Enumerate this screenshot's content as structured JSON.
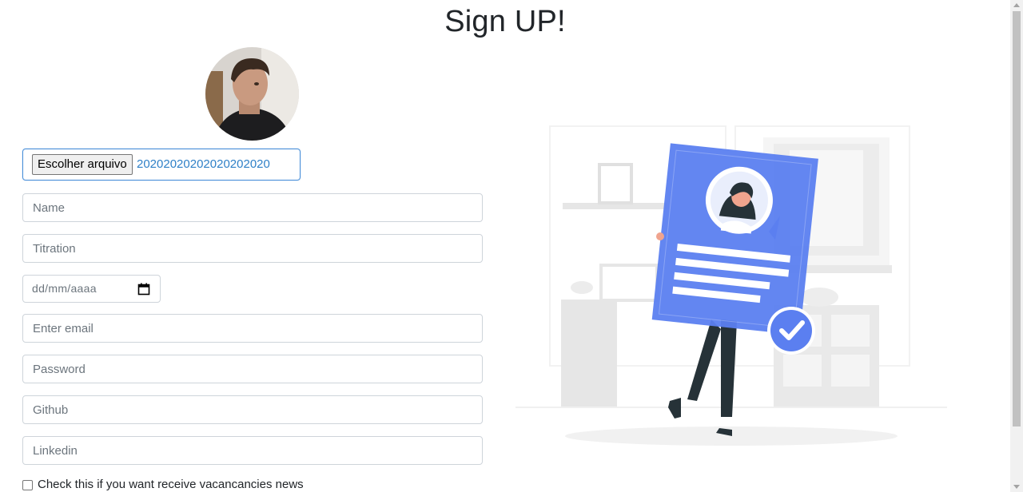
{
  "page": {
    "title": "Sign UP!"
  },
  "avatar": {
    "icon": "profile-photo"
  },
  "file_input": {
    "button_label": "Escolher arquivo",
    "file_name": "20202020202020202020"
  },
  "form": {
    "name_placeholder": "Name",
    "titration_placeholder": "Titration",
    "date_placeholder": "dd/mm/aaaa",
    "email_placeholder": "Enter email",
    "password_placeholder": "Password",
    "github_placeholder": "Github",
    "linkedin_placeholder": "Linkedin",
    "news_checkbox_label": "Check this if you want receive vacancancies news",
    "news_checked": false
  },
  "illustration": {
    "icon": "sign-up-illustration"
  },
  "colors": {
    "accent_blue": "#5b7ff0",
    "focus_border": "#4a90d9",
    "file_text": "#2f80c7",
    "input_border": "#ced4da"
  }
}
